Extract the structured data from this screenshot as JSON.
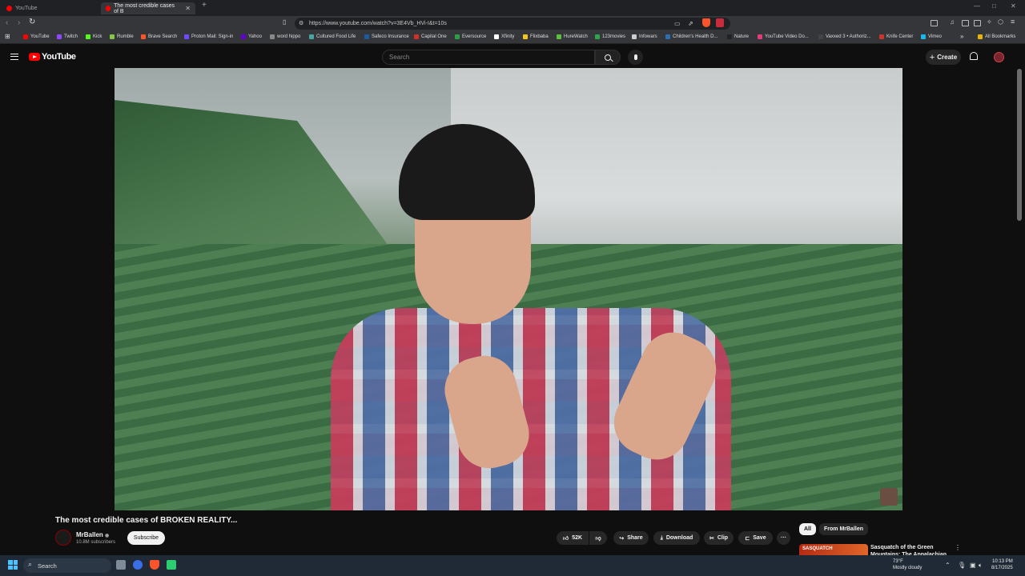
{
  "browser": {
    "tabs": [
      {
        "title": "YouTube"
      },
      {
        "title": "The most credible cases of B"
      }
    ],
    "new_tab": "+",
    "url": "https://www.youtube.com/watch?v=3E4Vb_HVi-I&t=10s",
    "bookmarks": [
      {
        "label": "YouTube",
        "color": "#ff0000"
      },
      {
        "label": "Twitch",
        "color": "#9146ff"
      },
      {
        "label": "Kick",
        "color": "#53fc18"
      },
      {
        "label": "Rumble",
        "color": "#85c742"
      },
      {
        "label": "Brave Search",
        "color": "#fb542b"
      },
      {
        "label": "Proton Mail: Sign-in",
        "color": "#6d4aff"
      },
      {
        "label": "Yahoo",
        "color": "#6001d2"
      },
      {
        "label": "word hippo",
        "color": "#888888"
      },
      {
        "label": "Cultured Food Life",
        "color": "#4aa3a3"
      },
      {
        "label": "Safeco Insurance",
        "color": "#1a5aa0"
      },
      {
        "label": "Capital One",
        "color": "#d03027"
      },
      {
        "label": "Eversource",
        "color": "#2e9b48"
      },
      {
        "label": "Xfinity",
        "color": "#ffffff"
      },
      {
        "label": "Flixbaba",
        "color": "#f5c518"
      },
      {
        "label": "HureWatch",
        "color": "#59c23a"
      },
      {
        "label": "123movies",
        "color": "#2ea44f"
      },
      {
        "label": "Infowars",
        "color": "#cccccc"
      },
      {
        "label": "Children's Health D...",
        "color": "#2a6fb0"
      },
      {
        "label": "Nature",
        "color": "#222222"
      },
      {
        "label": "YouTube Video Do...",
        "color": "#e23b7a"
      },
      {
        "label": "Vaxxed 3 • Authoriz...",
        "color": "#444444"
      },
      {
        "label": "Knife Center",
        "color": "#c8352b"
      },
      {
        "label": "Vimeo",
        "color": "#1ab7ea"
      }
    ],
    "bookmarks_overflow": "»",
    "all_bookmarks": "All Bookmarks"
  },
  "youtube": {
    "logo_text": "YouTube",
    "search_placeholder": "Search",
    "create_label": "Create",
    "video": {
      "title": "The most credible cases of BROKEN REALITY...",
      "channel": "MrBallen",
      "verified": "◉",
      "subscribers": "10.8M subscribers",
      "subscribe_label": "Subscribe",
      "likes": "52K",
      "share_label": "Share",
      "download_label": "Download",
      "clip_label": "Clip",
      "save_label": "Save",
      "more": "···"
    },
    "chips": [
      {
        "label": "All",
        "active": true
      },
      {
        "label": "From MrBallen",
        "active": false
      }
    ],
    "recommendation": {
      "thumb_text": "SASQUATCH",
      "title": "Sasquatch of the Green Mountains: The Appalachian"
    }
  },
  "taskbar": {
    "search_label": "Search",
    "weather_temp": "73°F",
    "weather_desc": "Mostly cloudy",
    "time": "10:13 PM",
    "date": "8/17/2025"
  },
  "colors": {
    "brand_red": "#ff0000",
    "background": "#0f0f0f",
    "accent_blue": "#4cc2ff"
  }
}
